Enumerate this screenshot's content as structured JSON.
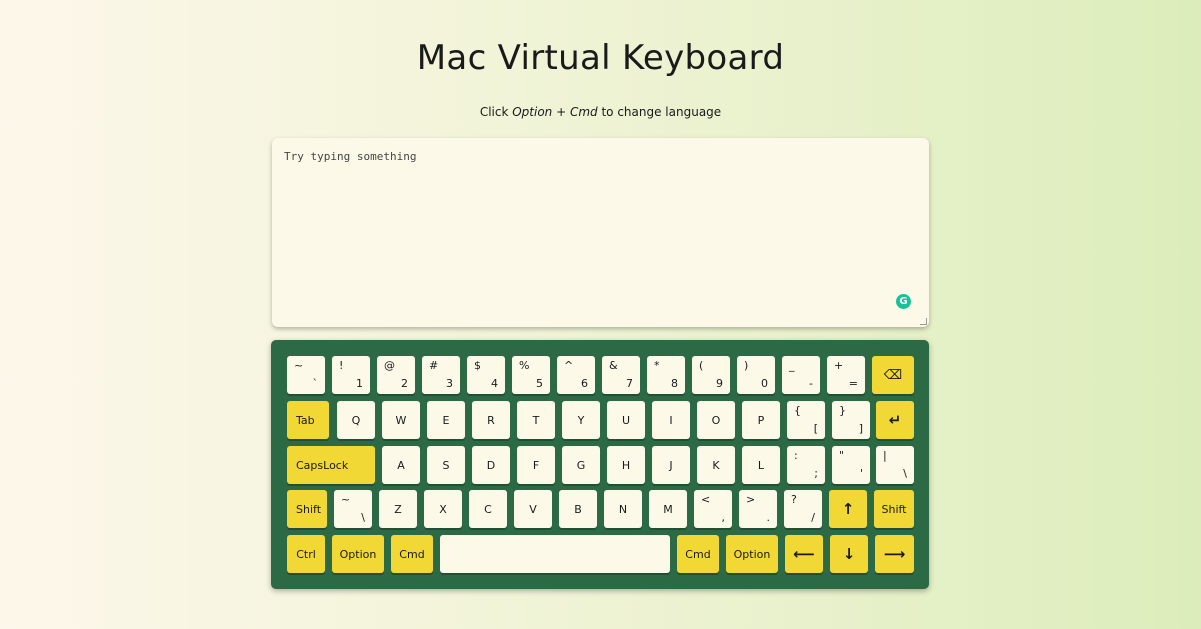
{
  "header": {
    "title": "Mac Virtual Keyboard",
    "subtitle_prefix": "Click ",
    "subtitle_keys": "Option + Cmd",
    "subtitle_suffix": " to change language"
  },
  "editor": {
    "placeholder": "Try typing something",
    "value": ""
  },
  "colors": {
    "keyboard_bg": "#2b6a45",
    "key_light": "#fdf9e9",
    "key_accent": "#f2d834",
    "grammarly": "#15c39a"
  },
  "keyboard": {
    "row1": [
      {
        "top": "~",
        "bottom": "`"
      },
      {
        "top": "!",
        "bottom": "1"
      },
      {
        "top": "@",
        "bottom": "2"
      },
      {
        "top": "#",
        "bottom": "3"
      },
      {
        "top": "$",
        "bottom": "4"
      },
      {
        "top": "%",
        "bottom": "5"
      },
      {
        "top": "^",
        "bottom": "6"
      },
      {
        "top": "&",
        "bottom": "7"
      },
      {
        "top": "*",
        "bottom": "8"
      },
      {
        "top": "(",
        "bottom": "9"
      },
      {
        "top": ")",
        "bottom": "0"
      },
      {
        "top": "_",
        "bottom": "-"
      },
      {
        "top": "+",
        "bottom": "="
      },
      {
        "icon": "⌫",
        "name": "backspace-icon"
      }
    ],
    "row2": {
      "tab": "Tab",
      "letters": [
        "Q",
        "W",
        "E",
        "R",
        "T",
        "Y",
        "U",
        "I",
        "O",
        "P"
      ],
      "symbols": [
        {
          "top": "{",
          "bottom": "["
        },
        {
          "top": "}",
          "bottom": "]"
        }
      ],
      "enter_icon": "↵"
    },
    "row3": {
      "capslock": "CapsLock",
      "letters": [
        "A",
        "S",
        "D",
        "F",
        "G",
        "H",
        "J",
        "K",
        "L"
      ],
      "symbols": [
        {
          "top": ":",
          "bottom": ";"
        },
        {
          "top": "\"",
          "bottom": "'"
        },
        {
          "top": "|",
          "bottom": "\\"
        }
      ]
    },
    "row4": {
      "shift_left": "Shift",
      "tilde": {
        "top": "~",
        "bottom": "\\"
      },
      "letters": [
        "Z",
        "X",
        "C",
        "V",
        "B",
        "N",
        "M"
      ],
      "symbols": [
        {
          "top": "<",
          "bottom": ","
        },
        {
          "top": ">",
          "bottom": "."
        },
        {
          "top": "?",
          "bottom": "/"
        }
      ],
      "arrow_up": "↑",
      "shift_right": "Shift"
    },
    "row5": {
      "ctrl": "Ctrl",
      "option_left": "Option",
      "cmd_left": "Cmd",
      "space": "",
      "cmd_right": "Cmd",
      "option_right": "Option",
      "arrow_left": "⟵",
      "arrow_down": "↓",
      "arrow_right": "⟶"
    }
  }
}
